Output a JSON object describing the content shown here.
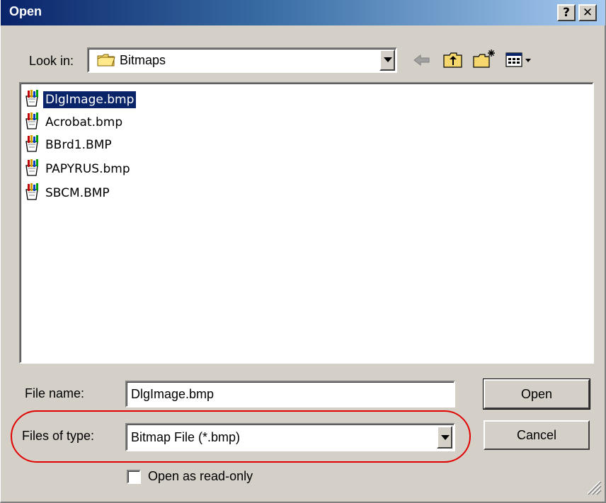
{
  "window": {
    "title": "Open"
  },
  "title_buttons": {
    "help": "?",
    "close": "✕"
  },
  "look_in": {
    "label": "Look in:",
    "value": "Bitmaps"
  },
  "toolbar": {
    "icons": [
      "back-arrow-icon",
      "up-folder-icon",
      "new-folder-icon",
      "view-menu-icon"
    ]
  },
  "files": [
    {
      "name": "DlgImage.bmp",
      "selected": true
    },
    {
      "name": "Acrobat.bmp",
      "selected": false
    },
    {
      "name": "BBrd1.BMP",
      "selected": false
    },
    {
      "name": "PAPYRUS.bmp",
      "selected": false
    },
    {
      "name": "SBCM.BMP",
      "selected": false
    }
  ],
  "file_name": {
    "label": "File name:",
    "value": "DlgImage.bmp"
  },
  "files_of_type": {
    "label": "Files of type:",
    "value": "Bitmap File (*.bmp)"
  },
  "buttons": {
    "open": "Open",
    "cancel": "Cancel"
  },
  "read_only": {
    "label": "Open as read-only",
    "checked": false
  },
  "colors": {
    "selection": "#0a246a",
    "highlight_oval": "#e00000",
    "face": "#d4d0c8"
  }
}
